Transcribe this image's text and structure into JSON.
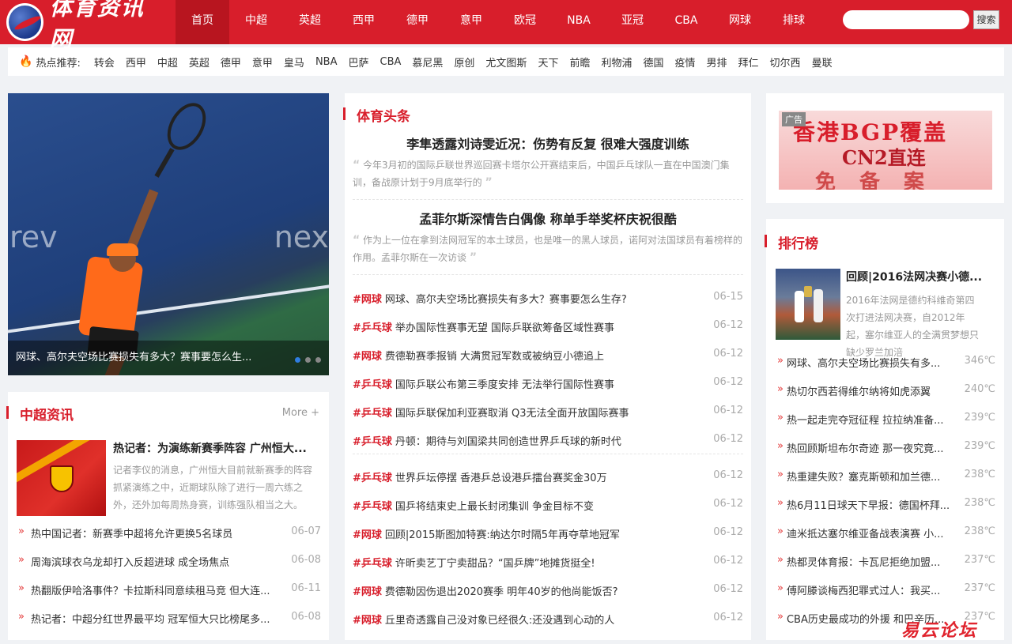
{
  "header": {
    "logo_text": "体育资讯网",
    "nav": [
      "首页",
      "中超",
      "英超",
      "西甲",
      "德甲",
      "意甲",
      "欧冠",
      "NBA",
      "亚冠",
      "CBA",
      "网球",
      "排球"
    ],
    "active_nav": 0,
    "search_button": "搜索",
    "accent_color": "#d81e2b"
  },
  "hotbar": {
    "label": "热点推荐:",
    "tags": [
      "转会",
      "西甲",
      "中超",
      "英超",
      "德甲",
      "意甲",
      "皇马",
      "NBA",
      "巴萨",
      "CBA",
      "慕尼黑",
      "原创",
      "尤文图斯",
      "天下",
      "前瞻",
      "利物浦",
      "德国",
      "疫情",
      "男排",
      "拜仁",
      "切尔西",
      "曼联"
    ]
  },
  "carousel": {
    "prev_label": "rev",
    "next_label": "nex",
    "caption": "网球、高尔夫空场比赛损失有多大？赛事要怎么生...",
    "active_dot": 0,
    "dot_count": 3
  },
  "csl": {
    "title": "中超资讯",
    "more": "More +",
    "feature_title": "热记者：为演练新赛季阵容 广州恒大...",
    "feature_summary": "记者李仪的消息，广州恒大目前就新赛季的阵容抓紧演练之中，近期球队除了进行一周六练之外，还外加每周热身赛，训练强队相当之大。",
    "items": [
      {
        "hot": "热",
        "text": "中国记者：新赛季中超将允许更换5名球员",
        "date": "06-07"
      },
      {
        "hot": "",
        "text": "周海滨球衣乌龙却打入反超进球 成全场焦点",
        "date": "06-08"
      },
      {
        "hot": "热",
        "text": "翻版伊哈洛事件？卡拉斯科同意续租马竞 但大连...",
        "date": "06-11"
      },
      {
        "hot": "热",
        "text": "记者：中超分红世界最平均 冠军恒大只比榜尾多...",
        "date": "06-08"
      }
    ]
  },
  "headlines": {
    "title": "体育头条",
    "top_stories": [
      {
        "title": "李隼透露刘诗雯近况：伤势有反复 很难大强度训练",
        "summary": "今年3月初的国际乒联世界巡回赛卡塔尔公开赛结束后，中国乒乓球队一直在中国澳门集训，备战原计划于9月底举行的"
      },
      {
        "title": "孟菲尔斯深情告白偶像 称单手举奖杯庆祝很酷",
        "summary": "作为上一位在拿到法网冠军的本土球员，也是唯一的黑人球员，诺阿对法国球员有着榜样的作用。孟菲尔斯在一次访谈"
      }
    ],
    "news_group1": [
      {
        "tag": "#网球",
        "text": "网球、高尔夫空场比赛损失有多大？赛事要怎么生存?",
        "date": "06-15"
      },
      {
        "tag": "#乒乓球",
        "text": "举办国际性赛事无望 国际乒联欲筹备区域性赛事",
        "date": "06-12"
      },
      {
        "tag": "#网球",
        "text": "费德勒赛季报销 大满贯冠军数或被纳豆小德追上",
        "date": "06-12"
      },
      {
        "tag": "#乒乓球",
        "text": "国际乒联公布第三季度安排 无法举行国际性赛事",
        "date": "06-12"
      },
      {
        "tag": "#乒乓球",
        "text": "国际乒联保加利亚赛取消 Q3无法全面开放国际赛事",
        "date": "06-12"
      },
      {
        "tag": "#乒乓球",
        "text": "丹顿：期待与刘国梁共同创造世界乒乓球的新时代",
        "date": "06-12"
      }
    ],
    "news_group2": [
      {
        "tag": "#乒乓球",
        "text": "世界乒坛停摆 香港乒总设港乒擂台赛奖金30万",
        "date": "06-12"
      },
      {
        "tag": "#乒乓球",
        "text": "国乒将结束史上最长封闭集训 争金目标不变",
        "date": "06-12"
      },
      {
        "tag": "#网球",
        "text": "回顾|2015斯图加特赛:纳达尔时隔5年再夺草地冠军",
        "date": "06-12"
      },
      {
        "tag": "#乒乓球",
        "text": "许昕卖艺丁宁卖甜品？“国乒牌”地摊货挺全!",
        "date": "06-12"
      },
      {
        "tag": "#网球",
        "text": "费德勒因伤退出2020赛季 明年40岁的他尚能饭否?",
        "date": "06-12"
      },
      {
        "tag": "#网球",
        "text": "丘里奇透露自己没对象已经很久:还没遇到心动的人",
        "date": "06-12"
      }
    ]
  },
  "ad": {
    "badge": "广告",
    "line1": "香港BGP覆盖",
    "line2": "CN2直连",
    "line3": "免备案"
  },
  "rank": {
    "title": "排行榜",
    "feature_title": "回顾|2016法网决赛小德...",
    "feature_summary": "2016年法网是德约科维奇第四次打进法网决赛，自2012年起，塞尔维亚人的全满贯梦想只缺少罗兰加涪",
    "items": [
      {
        "hot": "",
        "text": "网球、高尔夫空场比赛损失有多...",
        "temp": "346℃"
      },
      {
        "hot": "热",
        "text": "切尔西若得维尔纳将如虎添翼",
        "temp": "240℃"
      },
      {
        "hot": "热",
        "text": "一起走完夺冠征程 拉拉纳准备...",
        "temp": "239℃"
      },
      {
        "hot": "热",
        "text": "回顾斯坦布尔奇迹 那一夜究竟...",
        "temp": "239℃"
      },
      {
        "hot": "热",
        "text": "重建失败？塞克斯顿和加兰德...",
        "temp": "238℃"
      },
      {
        "hot": "热",
        "text": "6月11日球天下早报：德国杯拜...",
        "temp": "238℃"
      },
      {
        "hot": "",
        "text": "迪米抵达塞尔维亚备战表演赛 小...",
        "temp": "238℃"
      },
      {
        "hot": "热",
        "text": "都灵体育报：卡瓦尼拒绝加盟...",
        "temp": "237℃"
      },
      {
        "hot": "",
        "text": "傅阿滕谈梅西犯罪式过人：我买...",
        "temp": "237℃"
      },
      {
        "hot": "",
        "text": "CBA历史最成功的外援 和巴辛历...",
        "temp": "237℃"
      }
    ]
  },
  "watermark": "易云论坛"
}
